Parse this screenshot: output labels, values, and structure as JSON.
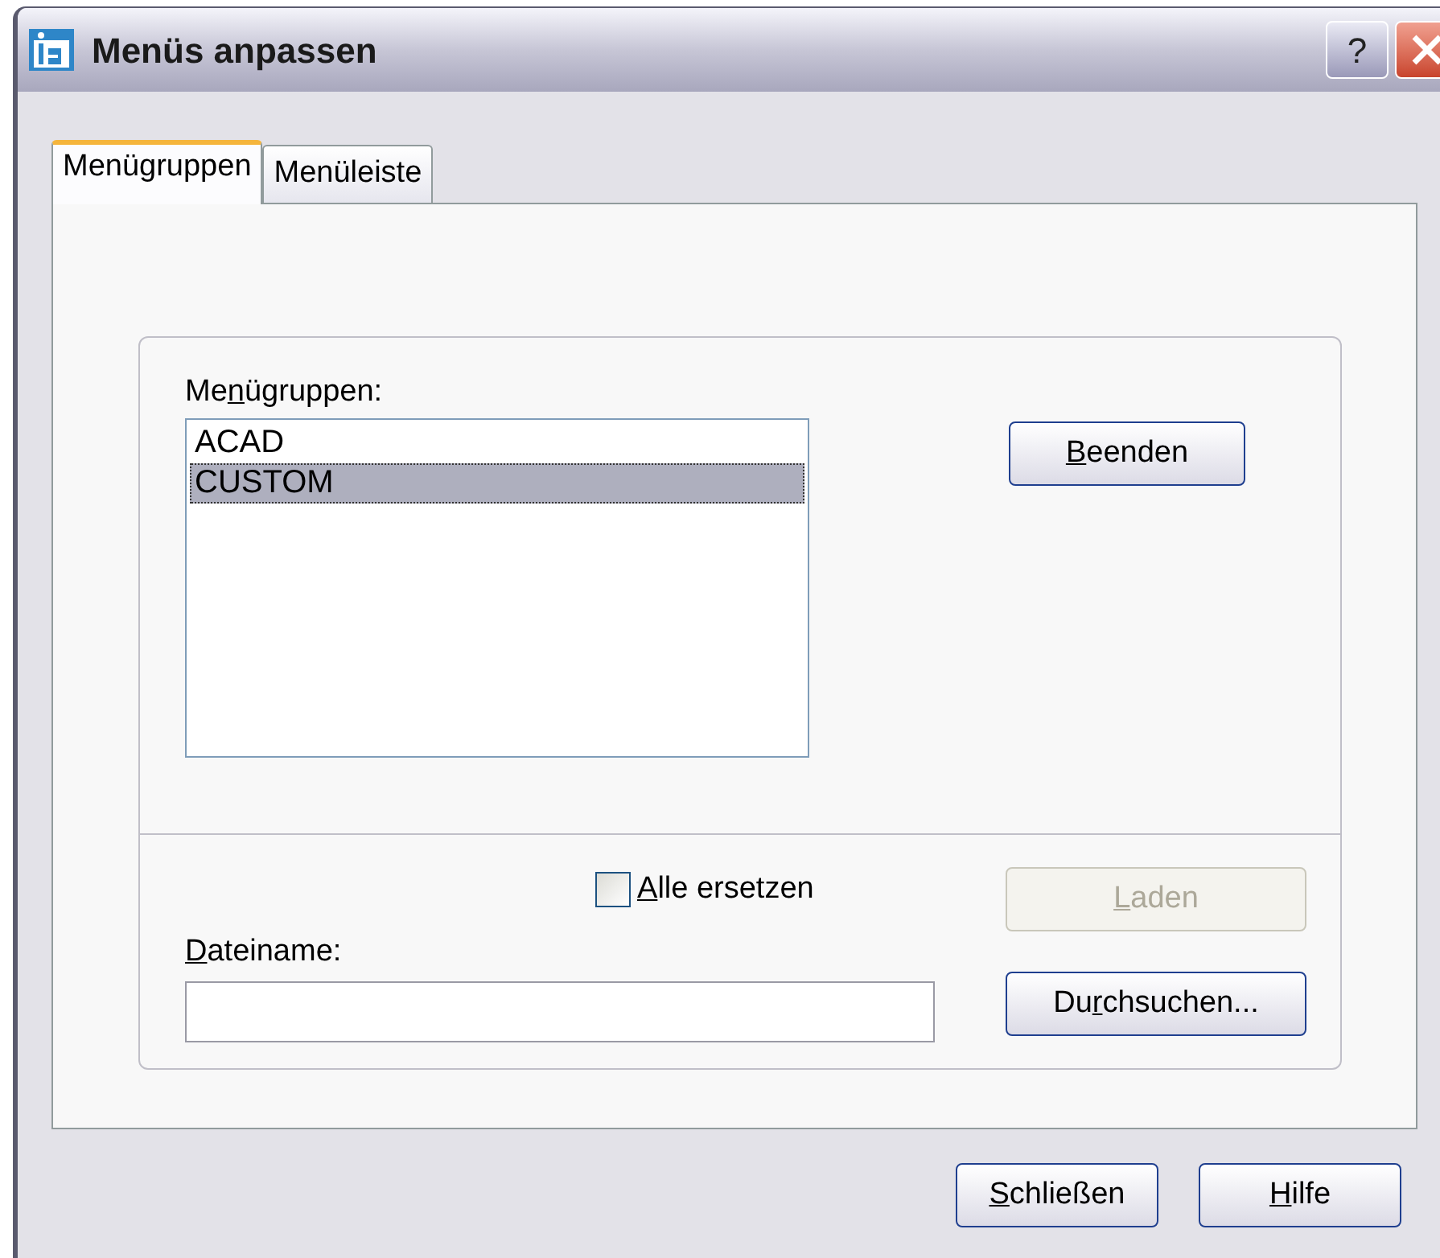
{
  "window": {
    "title": "Menüs anpassen",
    "title_buttons": [
      {
        "kind": "help",
        "label": "?"
      },
      {
        "kind": "close"
      }
    ]
  },
  "tabs": [
    {
      "label": {
        "after": "Menügruppen"
      },
      "selected": true
    },
    {
      "label": {
        "after": "Menüleiste"
      },
      "selected": false
    }
  ],
  "menu_groups": {
    "label": {
      "before": "Me",
      "key": "n",
      "after": "ügruppen:"
    },
    "items": [
      {
        "text": "ACAD",
        "selected": false
      },
      {
        "text": "CUSTOM",
        "selected": true
      }
    ]
  },
  "unload_button": {
    "label": {
      "key": "B",
      "after": "eenden"
    },
    "disabled": false
  },
  "replace_all": {
    "label": {
      "key": "A",
      "after": "lle ersetzen"
    },
    "checked": false
  },
  "load_button": {
    "label": {
      "key": "L",
      "after": "aden"
    },
    "disabled": true
  },
  "filename": {
    "label": {
      "key": "D",
      "after": "ateiname:"
    }
  },
  "browse_button": {
    "label": {
      "before": "Du",
      "key": "r",
      "after": "chsuchen..."
    },
    "disabled": false
  },
  "footer_buttons": [
    {
      "label": {
        "key": "S",
        "after": "chließen"
      },
      "disabled": false
    },
    {
      "label": {
        "key": "H",
        "after": "ilfe"
      },
      "disabled": false
    }
  ]
}
